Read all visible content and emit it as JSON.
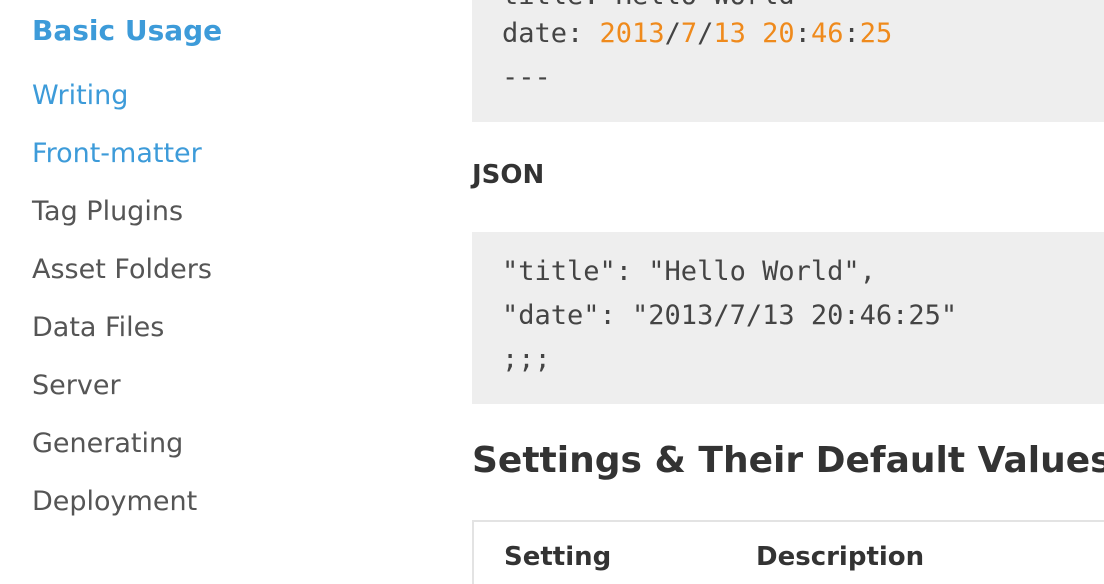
{
  "sidebar": {
    "heading": "Basic Usage",
    "items": [
      {
        "label": "Writing"
      },
      {
        "label": "Front-matter"
      },
      {
        "label": "Tag Plugins"
      },
      {
        "label": "Asset Folders"
      },
      {
        "label": "Data Files"
      },
      {
        "label": "Server"
      },
      {
        "label": "Generating"
      },
      {
        "label": "Deployment"
      }
    ]
  },
  "yaml_block": {
    "line1_partial": "title: Hello World",
    "date_key": "date: ",
    "date_year": "2013",
    "date_sep1": "/",
    "date_month": "7",
    "date_sep2": "/",
    "date_day": "13",
    "date_space": " ",
    "date_hour": "20",
    "date_colon1": ":",
    "date_min": "46",
    "date_colon2": ":",
    "date_sec": "25",
    "separator": "---"
  },
  "json_section": {
    "heading": "JSON",
    "lines": [
      "\"title\": \"Hello World\",",
      "\"date\": \"2013/7/13 20:46:25\"",
      ";;;"
    ]
  },
  "settings": {
    "heading": "Settings & Their Default Values",
    "columns": [
      "Setting",
      "Description"
    ]
  },
  "colors": {
    "link": "#3d9bd9",
    "number": "#ef8a1c",
    "code_bg": "#eeeeee"
  }
}
